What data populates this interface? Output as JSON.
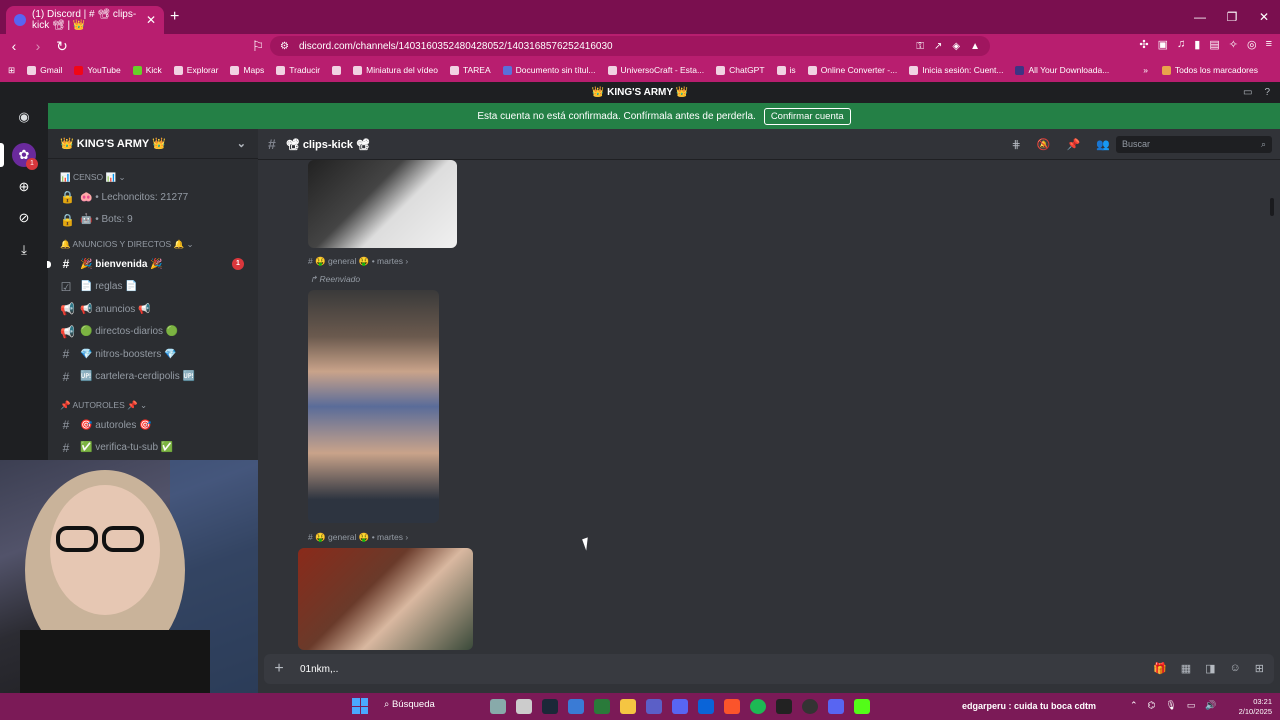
{
  "browser": {
    "tab_title": "(1) Discord | # 📽 clips-kick 📽 | 👑",
    "url": "discord.com/channels/1403160352480428052/1403168576252416030",
    "bookmarks": [
      "Gmail",
      "YouTube",
      "Kick",
      "Explorar",
      "Maps",
      "Traducir",
      "Miniatura del vídeo",
      "TAREA",
      "Documento sin títul...",
      "UniversoCraft - Esta...",
      "ChatGPT",
      "is",
      "Online Converter -...",
      "Inicia sesión: Cuent...",
      "All Your Downloada..."
    ],
    "bookmarks_folder": "Todos los marcadores"
  },
  "discord": {
    "server_title": "👑 KING'S ARMY 👑",
    "banner_text": "Esta cuenta no está confirmada. Confírmala antes de perderla.",
    "banner_button": "Confirmar cuenta",
    "rail_badge": "1",
    "server_name": "👑 KING'S ARMY 👑",
    "channels": [
      {
        "type": "category",
        "label": "📊 CENSO 📊 ⌄"
      },
      {
        "type": "locked",
        "label": "🐽 • Lechoncitos: 21277"
      },
      {
        "type": "locked",
        "label": "🤖 • Bots: 9"
      },
      {
        "type": "category",
        "label": "🔔 ANUNCIOS Y DIRECTOS 🔔 ⌄"
      },
      {
        "type": "text",
        "label": "🎉 bienvenida 🎉",
        "bold": true,
        "badge": "1"
      },
      {
        "type": "rules",
        "label": "📄 reglas 📄"
      },
      {
        "type": "announce",
        "label": "📢 anuncios 📢"
      },
      {
        "type": "announce",
        "label": "🟢 directos-diarios 🟢"
      },
      {
        "type": "text",
        "label": "💎 nitros-boosters 💎"
      },
      {
        "type": "text",
        "label": "🆙 cartelera-cerdipolis 🆙"
      },
      {
        "type": "category",
        "label": "📌 AUTOROLES 📌 ⌄"
      },
      {
        "type": "text",
        "label": "🎯 autoroles 🎯"
      },
      {
        "type": "text",
        "label": "✅ verifica-tu-sub ✅"
      }
    ],
    "channel_header": "📽 clips-kick 📽",
    "search_placeholder": "Buscar",
    "messages": {
      "meta1": "# 🤑 general 🤑 • martes ›",
      "forwarded": "↱ Reenviado",
      "meta2": "# 🤑 general 🤑 • martes ›"
    },
    "composer_text": "01nkm,.."
  },
  "taskbar": {
    "search_label": "Búsqueda",
    "notification": "edgarperu : cuida tu boca cdtm",
    "time": "03:21",
    "date": "2/10/2025"
  },
  "colors": {
    "browser_chrome": "#b81e6f",
    "discord_bg": "#313338",
    "banner_green": "#248046"
  }
}
